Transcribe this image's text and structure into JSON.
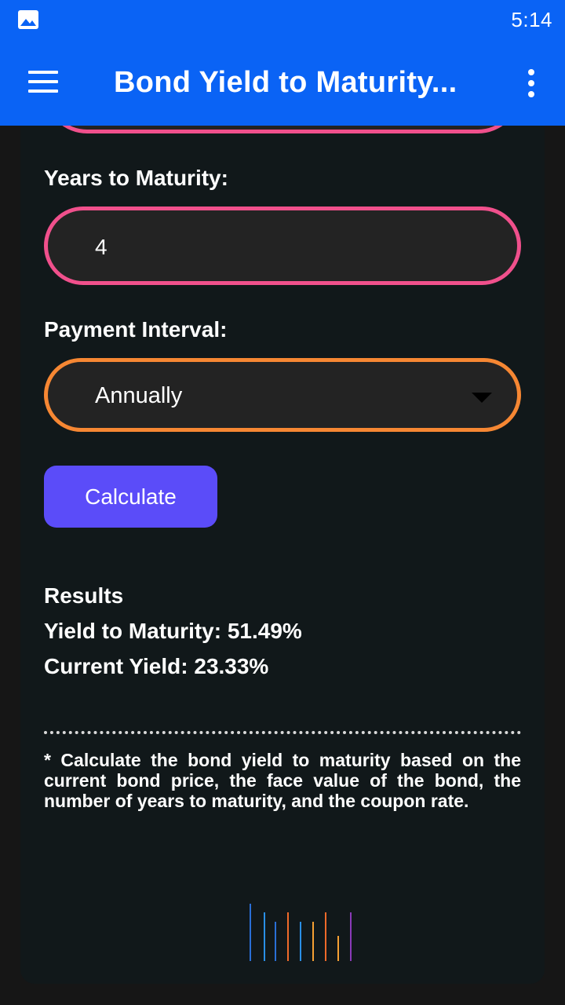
{
  "status_bar": {
    "time": "5:14",
    "image_icon": "image-icon"
  },
  "app_bar": {
    "title": "Bond Yield to Maturity...",
    "menu_icon": "hamburger-menu-icon",
    "more_icon": "more-vertical-icon"
  },
  "form": {
    "years_label": "Years to Maturity:",
    "years_value": "4",
    "interval_label": "Payment Interval:",
    "interval_value": "Annually",
    "calculate_label": "Calculate"
  },
  "results": {
    "heading": "Results",
    "ytm": "Yield to Maturity: 51.49%",
    "current_yield": "Current Yield: 23.33%"
  },
  "note": "* Calculate the bond yield to maturity based on the current bond price, the face value of the bond, the number of years to maturity, and the coupon rate.",
  "colors": {
    "app_bar": "#0a63f5",
    "card_bg": "#11181a",
    "field_border_pink": "#f0508c",
    "field_border_orange": "#f68733",
    "button": "#5b4cf9"
  },
  "logo": "bars-logo-icon"
}
